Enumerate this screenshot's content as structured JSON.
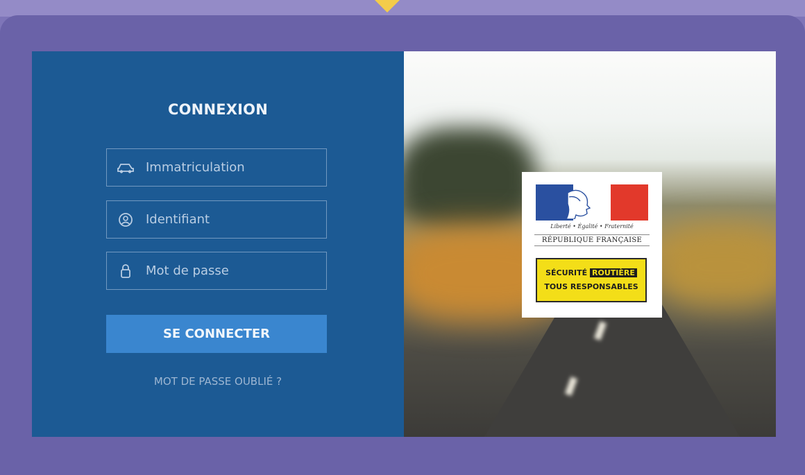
{
  "login": {
    "title": "CONNEXION",
    "fields": {
      "immatriculation": {
        "placeholder": "Immatriculation",
        "icon": "car-icon"
      },
      "identifiant": {
        "placeholder": "Identifiant",
        "icon": "user-icon"
      },
      "password": {
        "placeholder": "Mot de passe",
        "icon": "lock-icon"
      }
    },
    "submit_label": "SE CONNECTER",
    "forgot_label": "MOT DE PASSE OUBLIÉ ?"
  },
  "logo": {
    "motto": "Liberté • Égalité • Fraternité",
    "republic": "RÉPUBLIQUE FRANÇAISE",
    "campaign_word1": "SÉCURITÉ",
    "campaign_word2": "ROUTIÈRE",
    "campaign_line2": "TOUS RESPONSABLES"
  },
  "colors": {
    "frame": "#6a62a8",
    "login_panel": "#1c5a94",
    "button": "#3a86cf",
    "accent_notch": "#f4cc4a"
  }
}
